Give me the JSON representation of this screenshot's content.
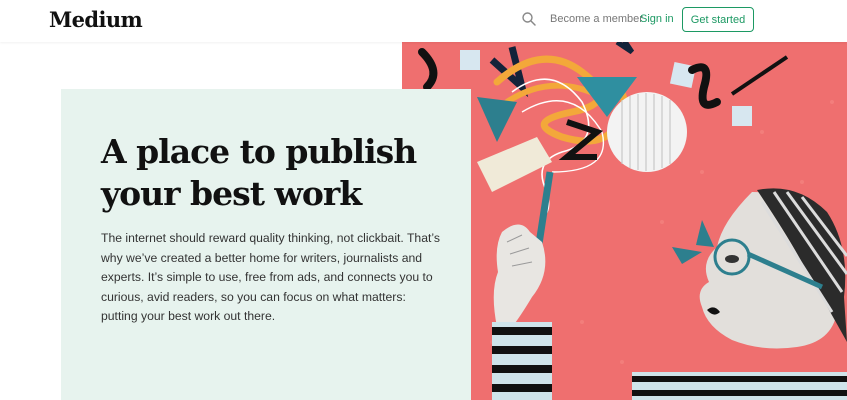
{
  "header": {
    "logo": "Medium",
    "search_icon": "search-icon",
    "become_member": "Become a member",
    "sign_in": "Sign in",
    "get_started": "Get started"
  },
  "hero": {
    "title_line1": "A place to publish",
    "title_line2": "your best work",
    "description": "The internet should reward quality thinking, not clickbait. That’s why we’ve created a better home for writers, journalists and experts. It’s simple to use, free from ads, and connects you to curious, avid readers, so you can focus on what matters: putting your best work out there."
  },
  "colors": {
    "accent_green": "#1c9963",
    "card_background": "#e7f3ee",
    "art_background": "#ef6f6f"
  }
}
